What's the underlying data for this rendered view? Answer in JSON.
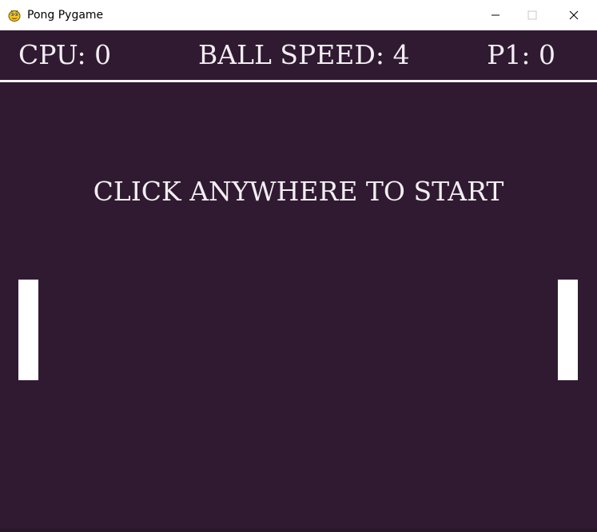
{
  "window": {
    "title": "Pong Pygame",
    "icon": "pygame-snake-icon"
  },
  "hud": {
    "cpu_label": "CPU: 0",
    "speed_label": "BALL SPEED: 4",
    "p1_label": "P1: 0"
  },
  "game": {
    "start_message": "CLICK ANYWHERE TO START"
  },
  "colors": {
    "background": "#301a31",
    "text": "#f2eef2",
    "paddle": "#ffffff",
    "divider": "#f4f4f4"
  }
}
